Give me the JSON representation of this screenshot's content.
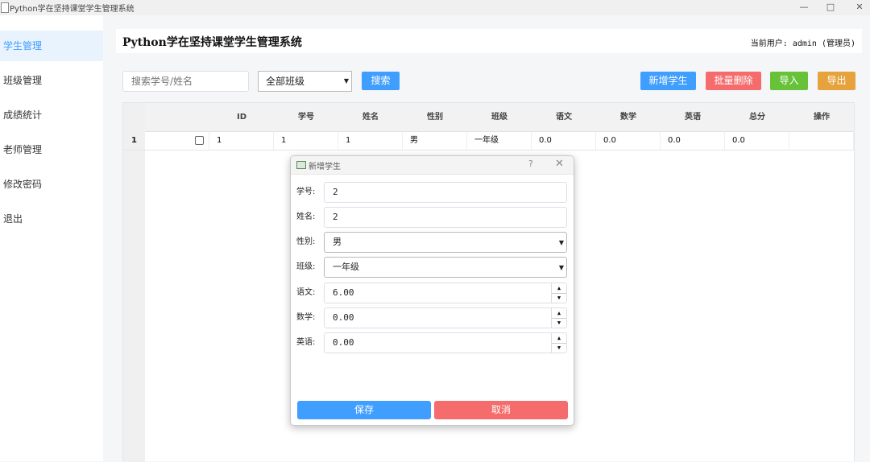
{
  "window": {
    "title": "Python学在坚持课堂学生管理系统",
    "minimize": "—",
    "maximize": "□",
    "close": "✕"
  },
  "sidebar": {
    "items": [
      {
        "label": "学生管理",
        "active": true
      },
      {
        "label": "班级管理"
      },
      {
        "label": "成绩统计"
      },
      {
        "label": "老师管理"
      },
      {
        "label": "修改密码"
      },
      {
        "label": "退出"
      }
    ]
  },
  "header": {
    "title": "Python学在坚持课堂学生管理系统",
    "user": "当前用户: admin (管理员)"
  },
  "toolbar": {
    "search_placeholder": "搜索学号/姓名",
    "class_select": "全部班级",
    "search_label": "搜索",
    "add_label": "新增学生",
    "batch_delete_label": "批量删除",
    "import_label": "导入",
    "export_label": "导出",
    "colors": {
      "primary": "#409eff",
      "danger": "#f56c6c",
      "success": "#67c23a",
      "warning": "#e6a23c"
    }
  },
  "table": {
    "columns": [
      "ID",
      "学号",
      "姓名",
      "性别",
      "班级",
      "语文",
      "数学",
      "英语",
      "总分",
      "操作"
    ],
    "rows": [
      {
        "num": "1",
        "cells": [
          "1",
          "1",
          "1",
          "男",
          "一年级",
          "0.0",
          "0.0",
          "0.0",
          "0.0",
          ""
        ]
      }
    ]
  },
  "dialog": {
    "title": "新增学生",
    "help": "?",
    "close": "✕",
    "fields": {
      "student_no": {
        "label": "学号:",
        "value": "2"
      },
      "name": {
        "label": "姓名:",
        "value": "2"
      },
      "gender": {
        "label": "性别:",
        "value": "男"
      },
      "class": {
        "label": "班级:",
        "value": "一年级"
      },
      "chinese": {
        "label": "语文:",
        "value": "6.00"
      },
      "math": {
        "label": "数学:",
        "value": "0.00"
      },
      "english": {
        "label": "英语:",
        "value": "0.00"
      }
    },
    "save_label": "保存",
    "cancel_label": "取消"
  }
}
